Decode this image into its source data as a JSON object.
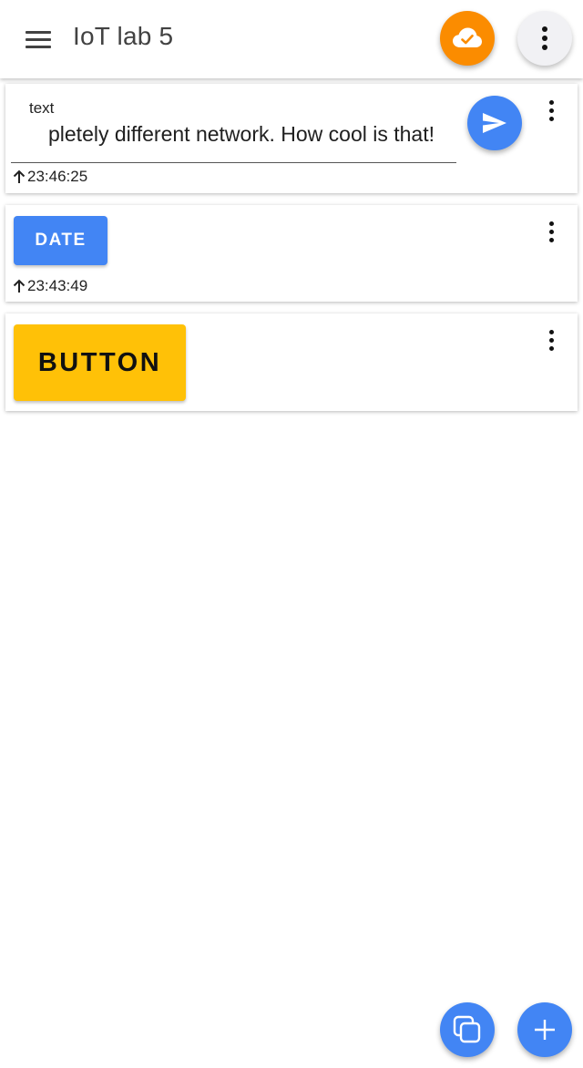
{
  "header": {
    "title": "IoT lab 5",
    "menu_icon": "menu-icon",
    "cloud_icon": "cloud-check-icon",
    "more_icon": "more-vert-icon"
  },
  "cards": [
    {
      "type": "text-input",
      "label": "text",
      "value": "pletely different network. How cool is that!",
      "send_icon": "send-icon",
      "timestamp": "23:46:25",
      "timestamp_icon": "arrow-up-icon"
    },
    {
      "type": "button",
      "button_label": "DATE",
      "timestamp": "23:43:49",
      "timestamp_icon": "arrow-up-icon"
    },
    {
      "type": "button",
      "button_label": "BUTTON"
    }
  ],
  "fabs": [
    {
      "icon": "copy-icon"
    },
    {
      "icon": "add-icon"
    }
  ],
  "colors": {
    "accent_blue": "#4285f4",
    "cloud_orange": "#fb8c00",
    "button_yellow": "#ffc107"
  }
}
